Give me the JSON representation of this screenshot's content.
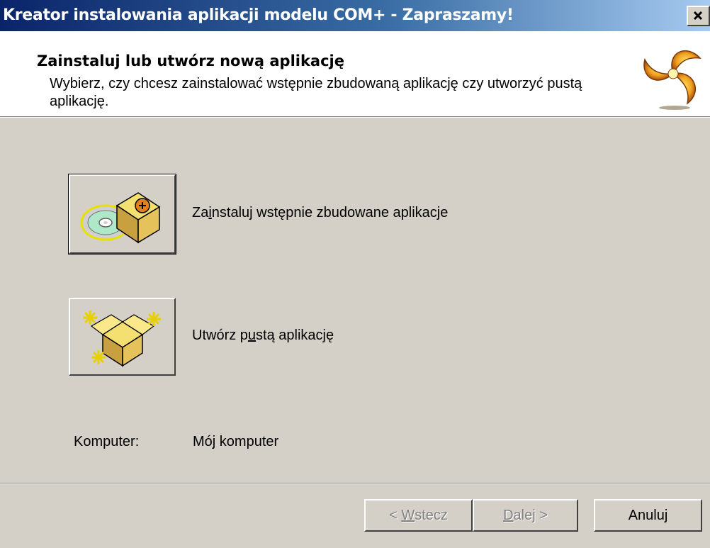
{
  "window": {
    "title": "Kreator instalowania aplikacji modelu COM+ - Zapraszamy!",
    "close_glyph": "✕"
  },
  "header": {
    "title": "Zainstaluj lub utwórz nową aplikację",
    "description": "Wybierz, czy chcesz zainstalować wstępnie zbudowaną aplikację czy utworzyć pustą aplikację.",
    "logo_icon": "com-plus-swirl-logo"
  },
  "options": {
    "install": {
      "label_before": "Za",
      "label_accel": "i",
      "label_after": "nstaluj wstępnie zbudowane aplikacje",
      "icon": "cd-with-package-icon"
    },
    "create": {
      "label_before": "Utwórz p",
      "label_accel": "u",
      "label_after": "stą aplikację",
      "icon": "empty-package-sparkle-icon"
    }
  },
  "computer": {
    "label": "Komputer:",
    "value": "Mój komputer"
  },
  "buttons": {
    "back": {
      "prefix": "< ",
      "accel": "W",
      "rest": "stecz",
      "enabled": false
    },
    "next": {
      "accel": "D",
      "rest": "alej",
      "suffix": " >",
      "enabled": false
    },
    "cancel": {
      "label": "Anuluj",
      "enabled": true
    }
  },
  "colors": {
    "titlebar_start": "#0a246a",
    "titlebar_end": "#a6caf0",
    "face": "#d4d0c8",
    "header_bg": "#ffffff"
  }
}
